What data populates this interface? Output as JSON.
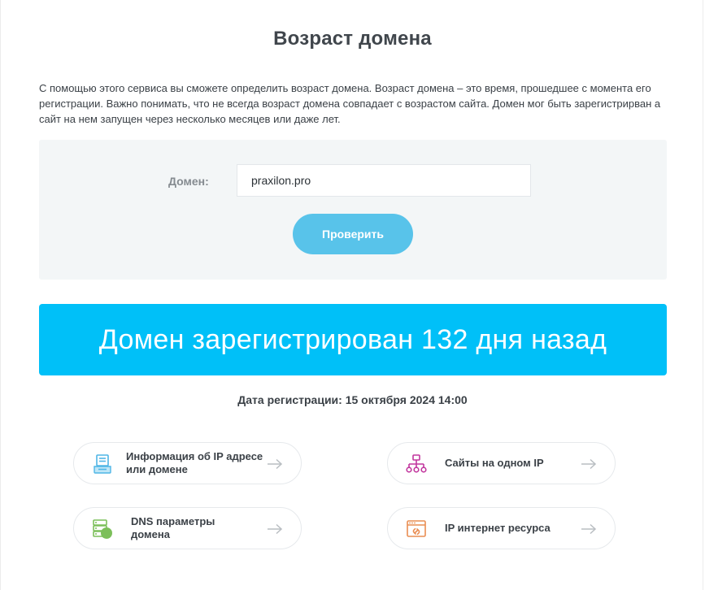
{
  "page": {
    "title": "Возраст домена",
    "intro": "С помощью этого сервиса вы сможете определить возраст домена. Возраст домена – это время, прошедшее с момента его регистрации. Важно понимать, что не всегда возраст домена совпадает с возрастом сайта. Домен мог быть зарегистрирван а сайт на нем запущен через несколько месяцев или даже лет."
  },
  "form": {
    "domain_label": "Домен:",
    "domain_value": "praxilon.pro",
    "check_button": "Проверить"
  },
  "result": {
    "banner": "Домен зарегистрирован 132 дня назад",
    "registration_date": "Дата регистрации: 15 октября 2024 14:00"
  },
  "tools": [
    {
      "label": "Информация об IP адресе или домене",
      "icon": "server-info-icon",
      "color": "#4fb6e6"
    },
    {
      "label": "Сайты на одном IP",
      "icon": "network-tree-icon",
      "color": "#c2379e"
    },
    {
      "label": "DNS параметры домена",
      "icon": "dns-server-icon",
      "color": "#7cbf5a"
    },
    {
      "label": "IP интернет ресурса",
      "icon": "browser-link-icon",
      "color": "#e98d52"
    }
  ],
  "colors": {
    "accent": "#00c0f8",
    "button": "#58c3ea",
    "form_background": "#f3f6f7"
  }
}
